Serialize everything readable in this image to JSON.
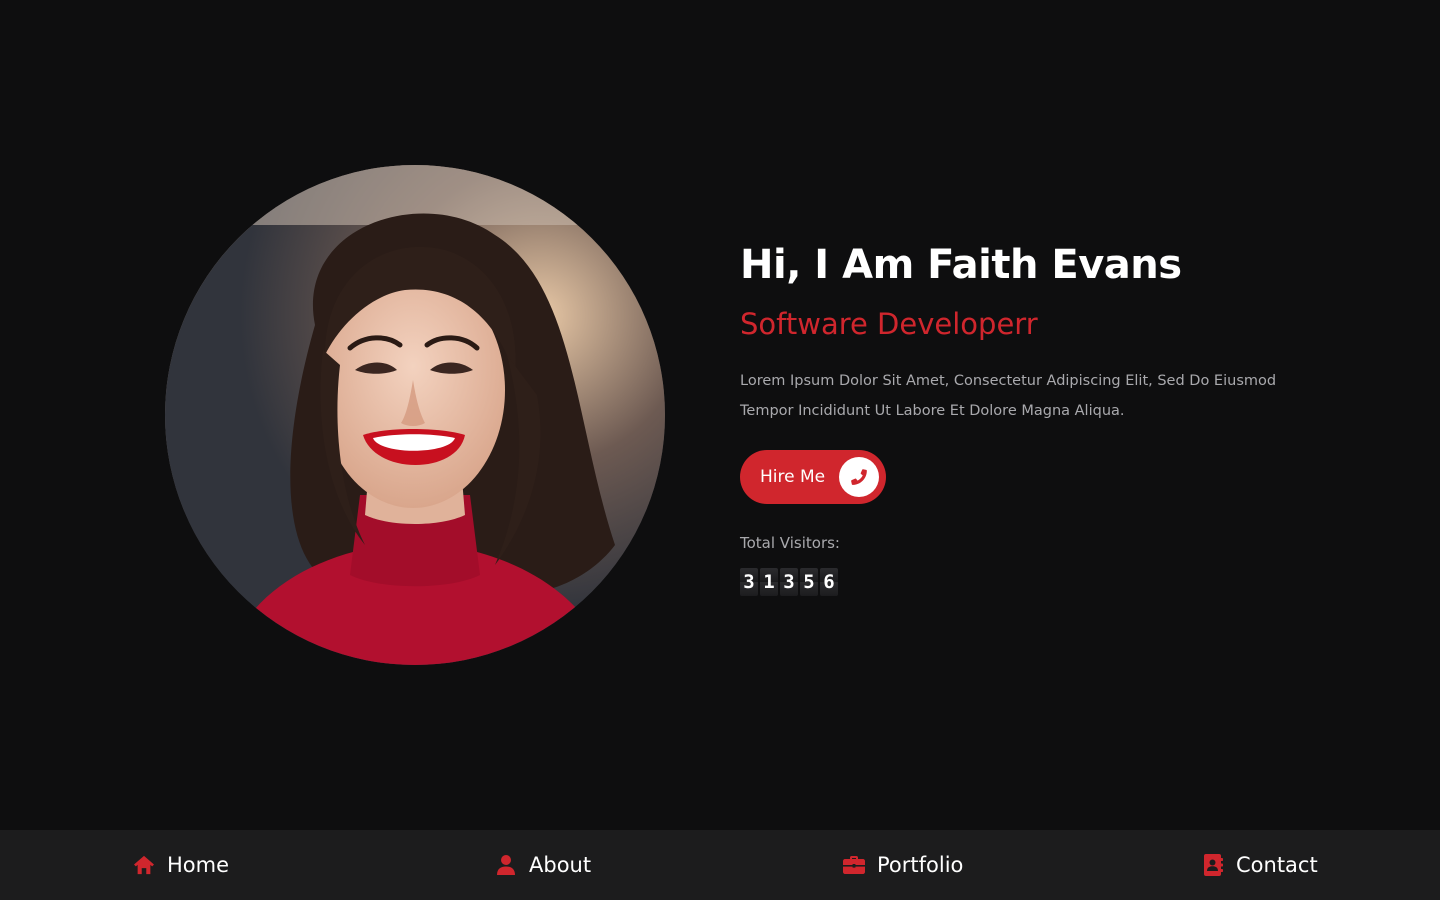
{
  "hero": {
    "headline": "Hi, I Am Faith Evans",
    "role": "Software Developerr",
    "bio": "Lorem Ipsum Dolor Sit Amet, Consectetur Adipiscing Elit, Sed Do Eiusmod Tempor Incididunt Ut Labore Et Dolore Magna Aliqua.",
    "hire_label": "Hire Me",
    "hire_icon": "phone-icon",
    "portrait_icon": "profile-photo"
  },
  "visitors": {
    "label": "Total Visitors:",
    "digits": [
      "3",
      "1",
      "3",
      "5",
      "6"
    ]
  },
  "nav": {
    "items": [
      {
        "label": "Home",
        "icon": "home-icon"
      },
      {
        "label": "About",
        "icon": "user-icon"
      },
      {
        "label": "Portfolio",
        "icon": "briefcase-icon"
      },
      {
        "label": "Contact",
        "icon": "address-book-icon"
      }
    ]
  },
  "colors": {
    "background": "#0e0e0f",
    "accent": "#d0262d",
    "nav_background": "#1c1c1d",
    "text_primary": "#ffffff",
    "text_muted": "#a9a9ad"
  }
}
